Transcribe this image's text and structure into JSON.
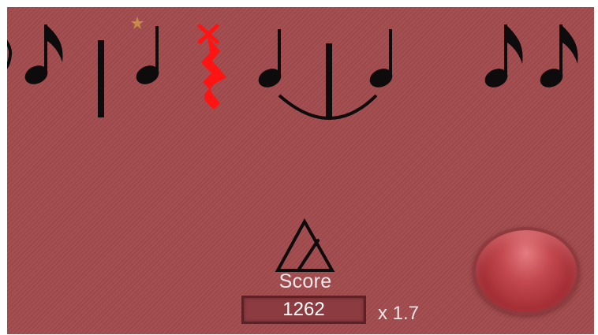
{
  "game": {
    "score_label": "Score",
    "score_value": "1262",
    "multiplier": "x 1.7",
    "colors": {
      "background": "#a24a4d",
      "note_color": "#0d0b0b",
      "miss_color": "#ff1414",
      "button_color": "#c44950"
    },
    "icons": {
      "metronome": "metronome-icon",
      "miss": "red-x-icon",
      "hit": "star-icon",
      "tap": "tap-button"
    }
  }
}
